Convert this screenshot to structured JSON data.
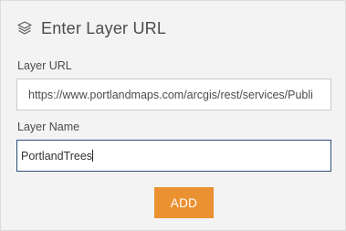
{
  "header": {
    "icon": "layers-icon",
    "title": "Enter Layer URL"
  },
  "layer_url": {
    "label": "Layer URL",
    "value": "https://www.portlandmaps.com/arcgis/rest/services/Publi"
  },
  "layer_name": {
    "label": "Layer Name",
    "value": "PortlandTrees"
  },
  "actions": {
    "add_label": "ADD",
    "accent_color": "#ea9131"
  }
}
